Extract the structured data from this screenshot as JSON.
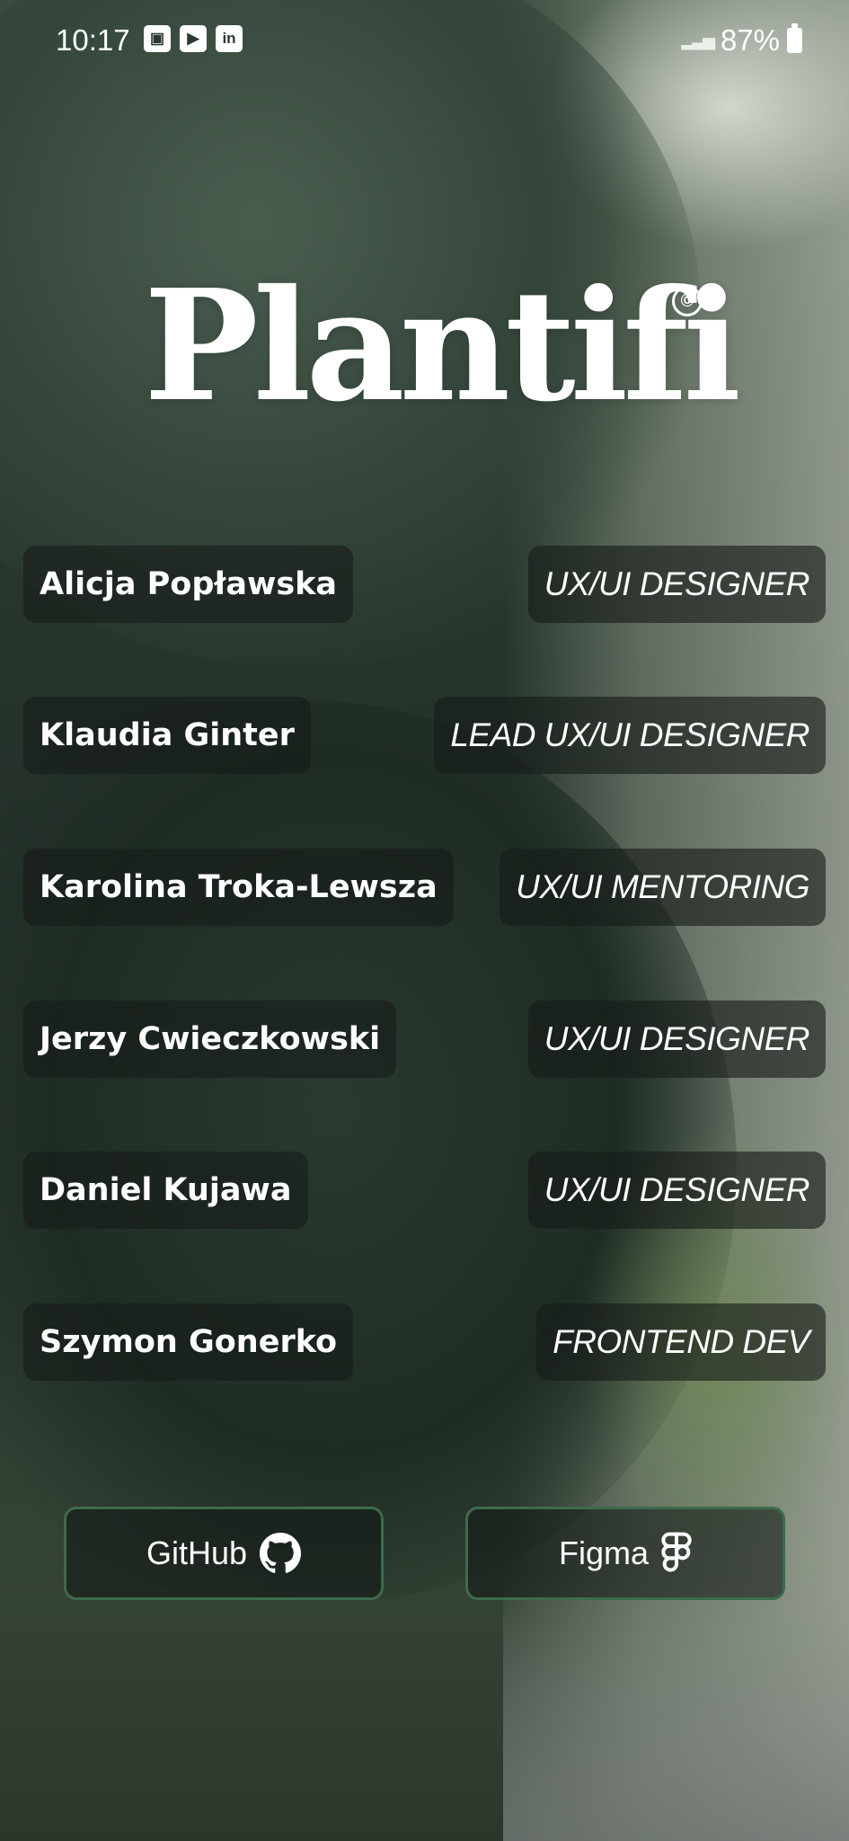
{
  "status_bar": {
    "time": "10:17",
    "battery": "87%",
    "notification_icons": [
      "image-icon",
      "youtube-icon",
      "linkedin-icon"
    ]
  },
  "brand": {
    "name": "Plantifi",
    "mark": "©"
  },
  "team": [
    {
      "name": "Alicja Popławska",
      "role": "UX/UI DESIGNER"
    },
    {
      "name": "Klaudia Ginter",
      "role": "LEAD UX/UI DESIGNER"
    },
    {
      "name": "Karolina Troka-Lewsza",
      "role": "UX/UI MENTORING"
    },
    {
      "name": "Jerzy Cwieczkowski",
      "role": "UX/UI DESIGNER"
    },
    {
      "name": "Daniel Kujawa",
      "role": "UX/UI DESIGNER"
    },
    {
      "name": "Szymon Gonerko",
      "role": "FRONTEND DEV"
    }
  ],
  "links": {
    "github_label": "GitHub",
    "figma_label": "Figma"
  },
  "colors": {
    "pill_background": "#161c18",
    "button_border": "#3d6b4c",
    "text": "#ffffff"
  }
}
